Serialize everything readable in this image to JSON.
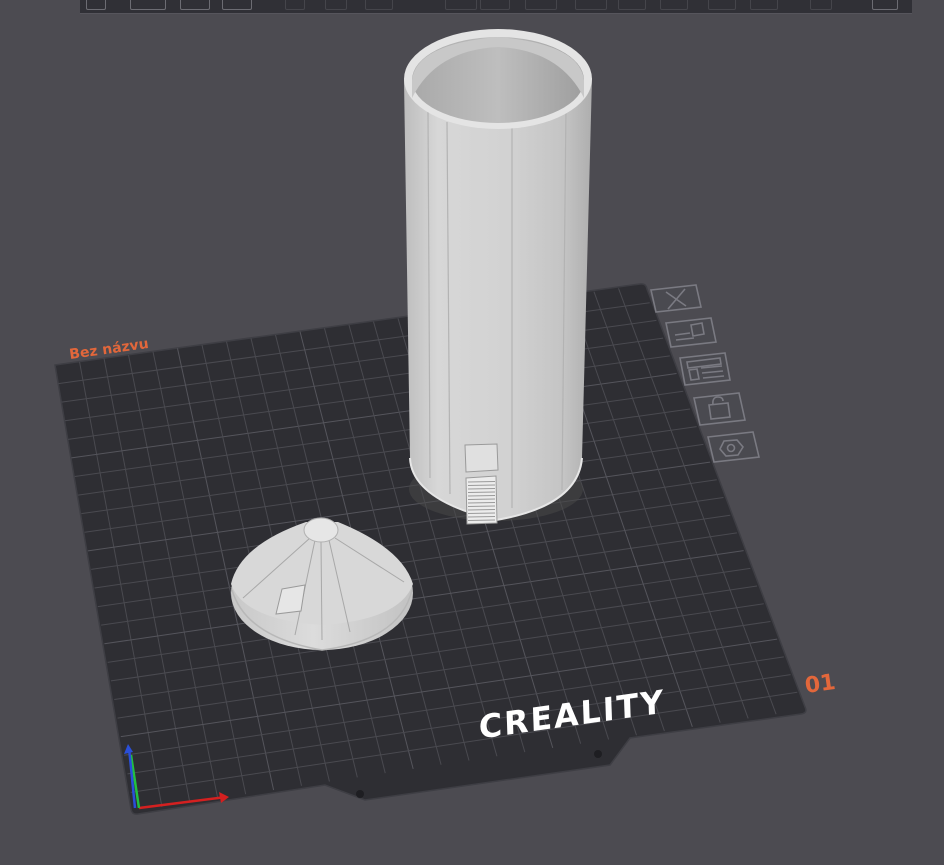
{
  "plate": {
    "name": "Bez názvu",
    "brand": "CREALITY",
    "number": "01"
  },
  "plate_tools": [
    {
      "name": "plate-close-button",
      "icon": "close-icon"
    },
    {
      "name": "plate-auto-orient-button",
      "icon": "auto-orient-icon"
    },
    {
      "name": "plate-arrange-button",
      "icon": "arrange-icon"
    },
    {
      "name": "plate-lock-button",
      "icon": "unlock-icon"
    },
    {
      "name": "plate-settings-button",
      "icon": "settings-hex-icon"
    }
  ],
  "axes": {
    "x_color": "#d42020",
    "y_color": "#22c040",
    "z_color": "#2a4fd8"
  },
  "colors": {
    "background": "#4c4b51",
    "plate": "#2e2e33",
    "grid": "#4a4a50",
    "accent": "#e2673b",
    "model": "#d6d6d6"
  }
}
